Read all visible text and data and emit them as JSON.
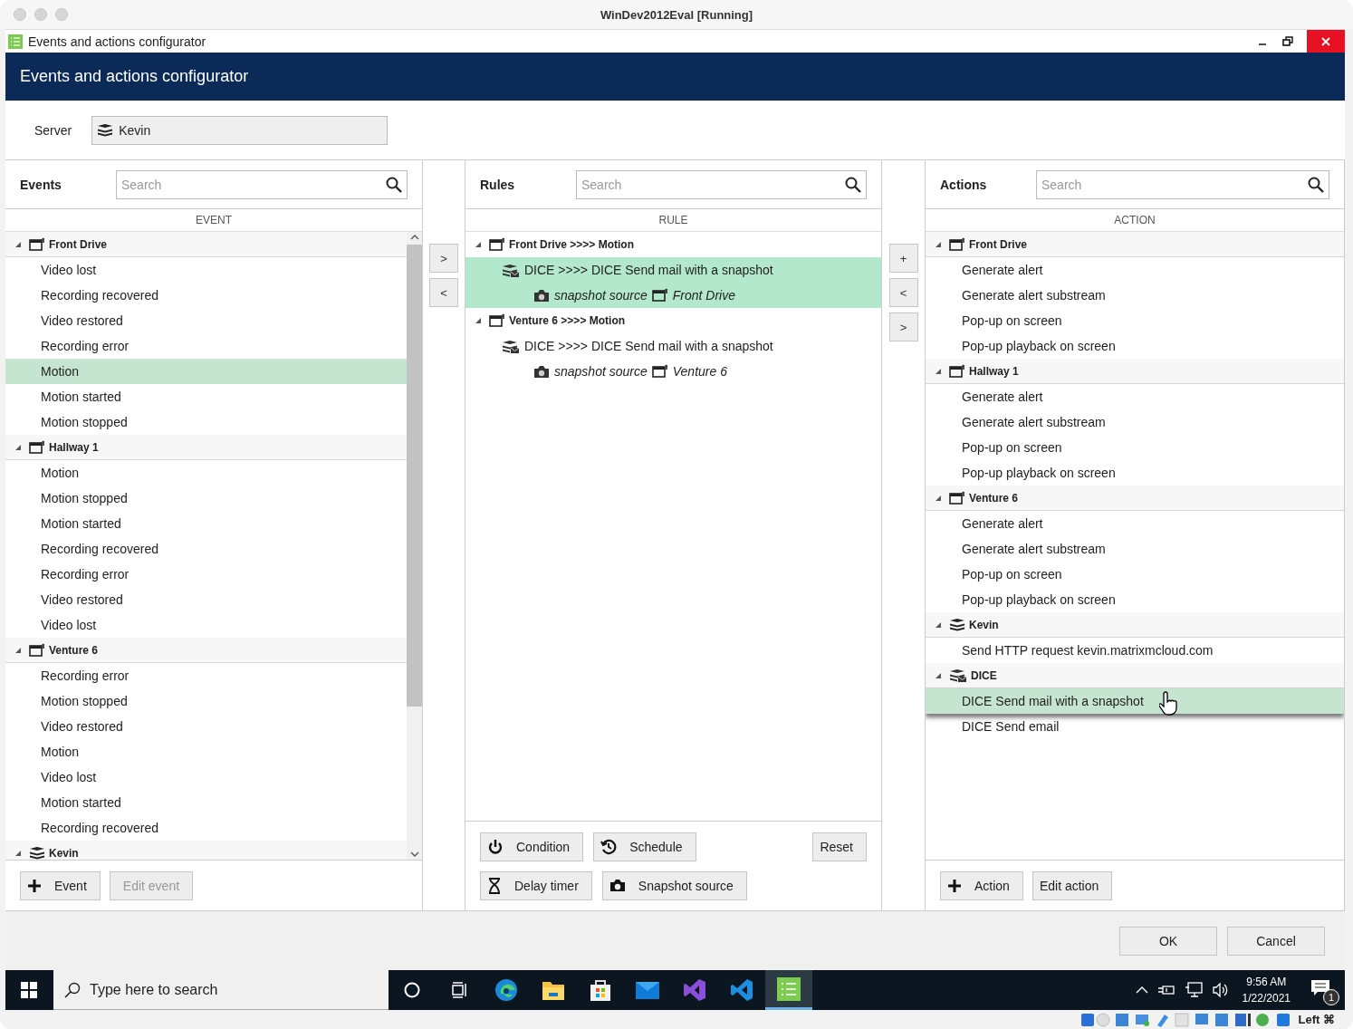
{
  "vm_window": {
    "title": "WinDev2012Eval [Running]"
  },
  "app_window": {
    "title": "Events and actions configurator"
  },
  "header": {
    "title": "Events and actions configurator"
  },
  "server": {
    "label": "Server",
    "value": "Kevin"
  },
  "events": {
    "title": "Events",
    "search": {
      "placeholder": "Search"
    },
    "column": "EVENT",
    "groups": [
      {
        "name": "Front Drive",
        "kind": "camera",
        "expanded": true,
        "children": [
          {
            "label": "Video lost",
            "selected": false
          },
          {
            "label": "Recording recovered",
            "selected": false
          },
          {
            "label": "Video restored",
            "selected": false
          },
          {
            "label": "Recording error",
            "selected": false
          },
          {
            "label": "Motion",
            "selected": true
          },
          {
            "label": "Motion started",
            "selected": false
          },
          {
            "label": "Motion stopped",
            "selected": false
          }
        ]
      },
      {
        "name": "Hallway 1",
        "kind": "camera",
        "expanded": true,
        "children": [
          {
            "label": "Motion",
            "selected": false
          },
          {
            "label": "Motion stopped",
            "selected": false
          },
          {
            "label": "Motion started",
            "selected": false
          },
          {
            "label": "Recording recovered",
            "selected": false
          },
          {
            "label": "Recording error",
            "selected": false
          },
          {
            "label": "Video restored",
            "selected": false
          },
          {
            "label": "Video lost",
            "selected": false
          }
        ]
      },
      {
        "name": "Venture 6",
        "kind": "camera",
        "expanded": true,
        "children": [
          {
            "label": "Recording error",
            "selected": false
          },
          {
            "label": "Motion stopped",
            "selected": false
          },
          {
            "label": "Video restored",
            "selected": false
          },
          {
            "label": "Motion",
            "selected": false
          },
          {
            "label": "Video lost",
            "selected": false
          },
          {
            "label": "Motion started",
            "selected": false
          },
          {
            "label": "Recording recovered",
            "selected": false
          }
        ]
      },
      {
        "name": "Kevin",
        "kind": "server",
        "expanded": true
      }
    ],
    "buttons": [
      {
        "label": "Event",
        "kind": "add",
        "disabled": false
      },
      {
        "label": "Edit event",
        "kind": "plain",
        "disabled": true
      }
    ]
  },
  "left_transfer_buttons": [
    ">",
    "<"
  ],
  "rules": {
    "title": "Rules",
    "search": {
      "placeholder": "Search"
    },
    "column": "RULE",
    "groups": [
      {
        "name": "Front Drive >>>> Motion",
        "expanded": true,
        "children": [
          {
            "text": "DICE >>>> DICE Send mail with a snapshot",
            "selected": true,
            "children": [
              {
                "label": "snapshot source",
                "camera": "Front Drive"
              }
            ]
          }
        ]
      },
      {
        "name": "Venture 6 >>>> Motion",
        "expanded": true,
        "children": [
          {
            "text": "DICE >>>> DICE Send mail with a snapshot",
            "selected": false,
            "children": [
              {
                "label": "snapshot source",
                "camera": "Venture 6"
              }
            ]
          }
        ]
      }
    ],
    "button_rows": [
      [
        {
          "label": "Condition",
          "kind": "condition"
        },
        {
          "label": "Schedule",
          "kind": "schedule"
        },
        {
          "label": "Reset",
          "kind": "reset"
        }
      ],
      [
        {
          "label": "Delay timer",
          "kind": "delay"
        },
        {
          "label": "Snapshot source",
          "kind": "snapshot"
        }
      ]
    ]
  },
  "right_transfer_buttons": [
    "+",
    "<",
    ">"
  ],
  "actions": {
    "title": "Actions",
    "search": {
      "placeholder": "Search"
    },
    "column": "ACTION",
    "groups": [
      {
        "name": "Front Drive",
        "kind": "camera",
        "expanded": true,
        "children": [
          {
            "label": "Generate alert",
            "selected": false
          },
          {
            "label": "Generate alert substream",
            "selected": false
          },
          {
            "label": "Pop-up on screen",
            "selected": false
          },
          {
            "label": "Pop-up playback on screen",
            "selected": false
          }
        ]
      },
      {
        "name": "Hallway 1",
        "kind": "camera",
        "expanded": true,
        "children": [
          {
            "label": "Generate alert",
            "selected": false
          },
          {
            "label": "Generate alert substream",
            "selected": false
          },
          {
            "label": "Pop-up on screen",
            "selected": false
          },
          {
            "label": "Pop-up playback on screen",
            "selected": false
          }
        ]
      },
      {
        "name": "Venture 6",
        "kind": "camera",
        "expanded": true,
        "children": [
          {
            "label": "Generate alert",
            "selected": false
          },
          {
            "label": "Generate alert substream",
            "selected": false
          },
          {
            "label": "Pop-up on screen",
            "selected": false
          },
          {
            "label": "Pop-up playback on screen",
            "selected": false
          }
        ]
      },
      {
        "name": "Kevin",
        "kind": "server",
        "expanded": true,
        "children": [
          {
            "label": "Send HTTP request kevin.matrixmcloud.com",
            "selected": false
          }
        ]
      },
      {
        "name": "DICE",
        "kind": "mail_server",
        "expanded": true,
        "children": [
          {
            "label": "DICE Send mail with a snapshot",
            "selected": true
          },
          {
            "label": "DICE Send email",
            "selected": false
          }
        ]
      }
    ],
    "buttons": [
      {
        "label": "Action",
        "kind": "add",
        "disabled": false
      },
      {
        "label": "Edit action",
        "kind": "plain",
        "disabled": false
      }
    ]
  },
  "dialog_buttons": [
    "OK",
    "Cancel"
  ],
  "taskbar": {
    "search_placeholder": "Type here to search",
    "apps": [
      {
        "kind": "cortana",
        "selected": false
      },
      {
        "kind": "task_view",
        "selected": false
      },
      {
        "kind": "edge",
        "selected": false
      },
      {
        "kind": "explorer",
        "selected": false
      },
      {
        "kind": "store",
        "selected": false
      },
      {
        "kind": "mail",
        "selected": false
      },
      {
        "kind": "visual_studio",
        "selected": false
      },
      {
        "kind": "vscode",
        "selected": false
      },
      {
        "kind": "configurator",
        "selected": true
      }
    ],
    "time": "9:56 AM",
    "date": "1/22/2021",
    "notifications": "1"
  },
  "vm_status": {
    "host_key": "Left ⌘"
  }
}
